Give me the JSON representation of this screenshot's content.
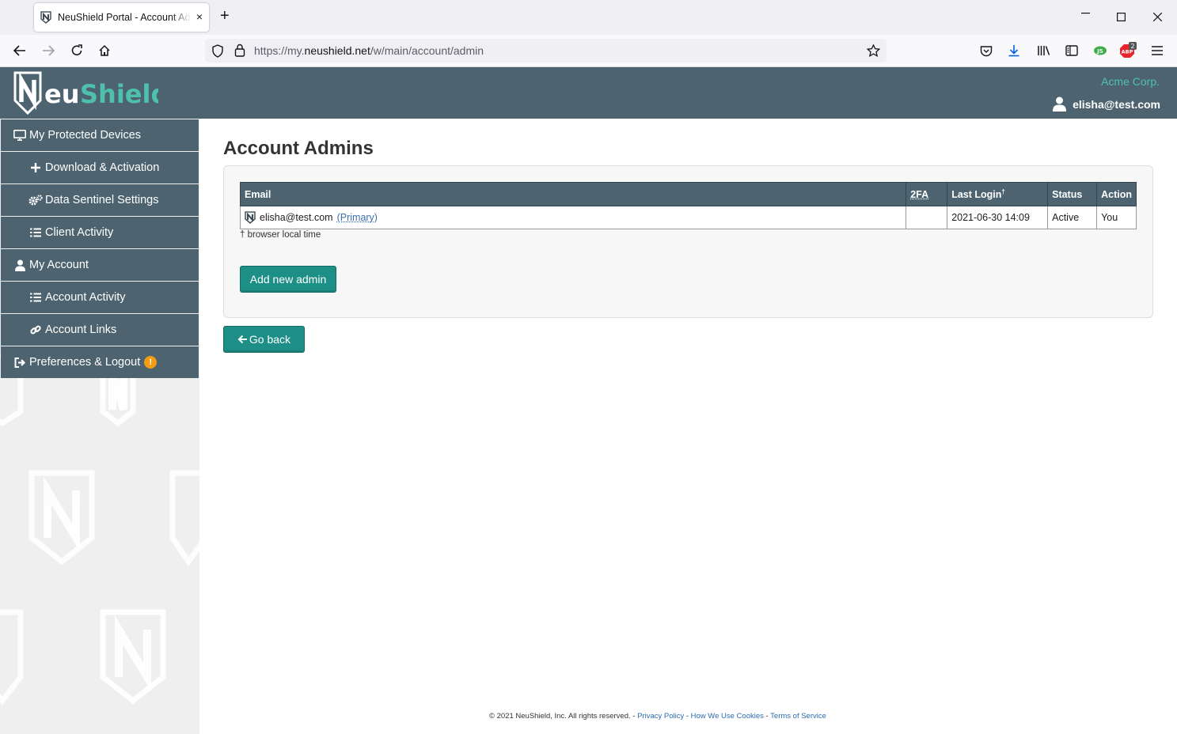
{
  "browser": {
    "tab_title": "NeuShield Portal - Account Admins",
    "new_tab": "+",
    "close_tab": "×",
    "url_prefix": "https://my.",
    "url_domain": "neushield.net",
    "url_path": "/w/main/account/admin",
    "abp_count": "2"
  },
  "header": {
    "org": "Acme Corp.",
    "user": "elisha@test.com"
  },
  "sidebar": {
    "items": [
      {
        "label": "My Protected Devices",
        "icon": "monitor-icon"
      },
      {
        "label": "Download & Activation",
        "icon": "plus-icon"
      },
      {
        "label": "Data Sentinel Settings",
        "icon": "cogs-icon"
      },
      {
        "label": "Client Activity",
        "icon": "list-icon"
      },
      {
        "label": "My Account",
        "icon": "user-icon"
      },
      {
        "label": "Account Activity",
        "icon": "list-icon"
      },
      {
        "label": "Account Links",
        "icon": "link-icon"
      },
      {
        "label": "Preferences & Logout",
        "icon": "sign-out-icon",
        "badge": "!"
      }
    ]
  },
  "main": {
    "title": "Account Admins",
    "table": {
      "headers": {
        "email": "Email",
        "twofa": "2FA",
        "last_login": "Last Login",
        "last_login_mark": "†",
        "status": "Status",
        "action": "Action"
      },
      "rows": [
        {
          "email": "elisha@test.com",
          "primary": "(Primary)",
          "twofa": "",
          "last_login": "2021-06-30 14:09",
          "status": "Active",
          "action": "You"
        }
      ]
    },
    "note": "† browser local time",
    "add_button": "Add new admin",
    "back_button": "Go back"
  },
  "footer": {
    "copyright": "© 2021 NeuShield, Inc. All rights reserved. - ",
    "privacy": "Privacy Policy",
    "sep1": " - ",
    "cookies": "How We Use Cookies",
    "sep2": " - ",
    "terms": "Terms of Service"
  },
  "colors": {
    "header": "#4d6470",
    "accent": "#1e8f87",
    "brand_teal": "#4ec1ad"
  }
}
